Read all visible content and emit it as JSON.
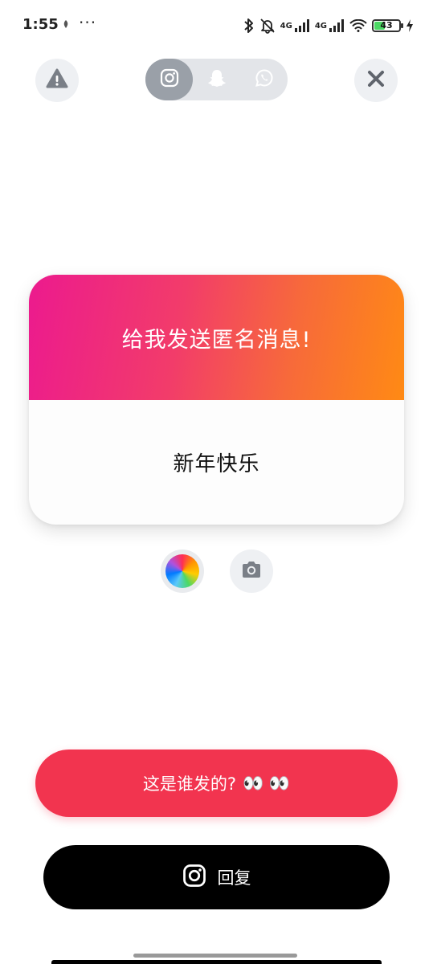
{
  "status_bar": {
    "time": "1:55",
    "dots": "···",
    "network_1": "4G",
    "network_2": "4G",
    "battery": "43"
  },
  "top_bar": {
    "warning_icon": "warning-icon",
    "close_icon": "close-icon",
    "platforms": [
      {
        "icon": "instagram-icon",
        "active": true
      },
      {
        "icon": "snapchat-icon",
        "active": false
      },
      {
        "icon": "whatsapp-icon",
        "active": false
      }
    ]
  },
  "card": {
    "title": "给我发送匿名消息!",
    "message": "新年快乐",
    "gradient_start": "#ec1a8e",
    "gradient_end": "#ff8a14"
  },
  "tools": {
    "color_icon": "color-wheel-icon",
    "camera_icon": "camera-icon"
  },
  "actions": {
    "who_sent_label": "这是谁发的?",
    "who_sent_emoji": "👀 👀",
    "reply_label": "回复",
    "who_sent_color": "#f2344f",
    "reply_color": "#000000"
  }
}
